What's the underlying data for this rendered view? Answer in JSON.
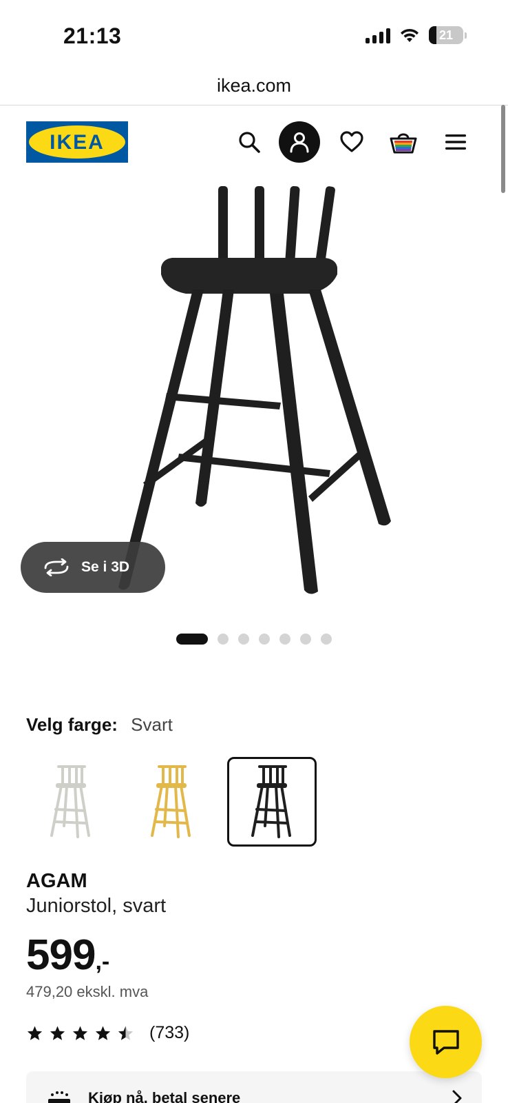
{
  "status_bar": {
    "time": "21:13",
    "battery": "21",
    "battery_level": 0.21
  },
  "browser": {
    "url": "ikea.com"
  },
  "header": {
    "logo_text": "IKEA",
    "icons": [
      "search-icon",
      "profile-icon",
      "heart-icon",
      "basket-icon",
      "menu-icon"
    ],
    "brand_blue": "#0058a3",
    "brand_yellow": "#fbd914"
  },
  "gallery": {
    "view_3d_label": "Se i 3D",
    "total_images": 7,
    "active_index": 0
  },
  "color_picker": {
    "label": "Velg farge:",
    "selected": "Svart",
    "options": [
      {
        "color": "#f0f0ec",
        "selected": false
      },
      {
        "color": "#e3b84a",
        "selected": false
      },
      {
        "color": "#1f1f1f",
        "selected": true
      }
    ]
  },
  "product": {
    "name": "AGAM",
    "description": "Juniorstol, svart",
    "price": "599",
    "price_suffix": ",-",
    "price_ex_vat": "479,20 ekskl. mva",
    "rating": 4.5,
    "rating_count": "(733)"
  },
  "banner": {
    "text": "Kjøp nå, betal senere"
  }
}
